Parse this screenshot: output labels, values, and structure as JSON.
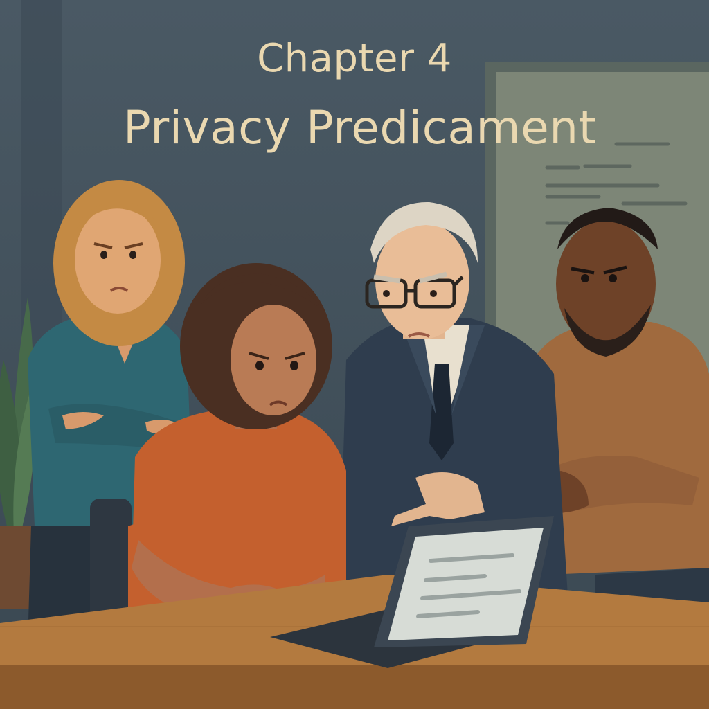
{
  "cover": {
    "chapter_label": "Chapter 4",
    "title": "Privacy Predicament"
  },
  "palette": {
    "wall": "#44535f",
    "title_text": "#ead8b0",
    "desk": "#b37a3f",
    "laptop": "#3b4652",
    "screen": "#d7dcd6"
  },
  "figures": [
    {
      "role": "woman-standing-arms-crossed",
      "shirt": "#2e6772"
    },
    {
      "role": "young-woman-seated-worried",
      "shirt": "#c4602e"
    },
    {
      "role": "older-man-in-suit-pointing",
      "suit": "#2f3d4e"
    },
    {
      "role": "bearded-man-pointing",
      "sweater": "#a06a3e"
    }
  ]
}
